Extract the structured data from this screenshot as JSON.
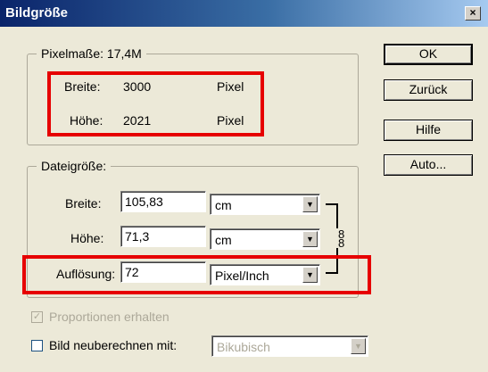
{
  "window": {
    "title": "Bildgröße",
    "close_label": "×"
  },
  "pixel_dimensions": {
    "legend": "Pixelmaße: 17,4M",
    "width": {
      "label": "Breite:",
      "value": "3000",
      "unit": "Pixel"
    },
    "height": {
      "label": "Höhe:",
      "value": "2021",
      "unit": "Pixel"
    }
  },
  "document_size": {
    "legend": "Dateigröße:",
    "width": {
      "label": "Breite:",
      "value": "105,83",
      "unit": "cm"
    },
    "height": {
      "label": "Höhe:",
      "value": "71,3",
      "unit": "cm"
    },
    "resolution": {
      "label": "Auflösung:",
      "value": "72",
      "unit": "Pixel/Inch"
    }
  },
  "options": {
    "constrain": {
      "label": "Proportionen erhalten",
      "checked": true,
      "mark": "☑"
    },
    "resample": {
      "label": "Bild neuberechnen mit:",
      "checked": false,
      "method": "Bikubisch"
    }
  },
  "buttons": {
    "ok": "OK",
    "back": "Zurück",
    "help": "Hilfe",
    "auto": "Auto..."
  },
  "icons": {
    "dropdown": "▼",
    "check": "✓",
    "chain": "8"
  },
  "highlight_color": "#e60000"
}
